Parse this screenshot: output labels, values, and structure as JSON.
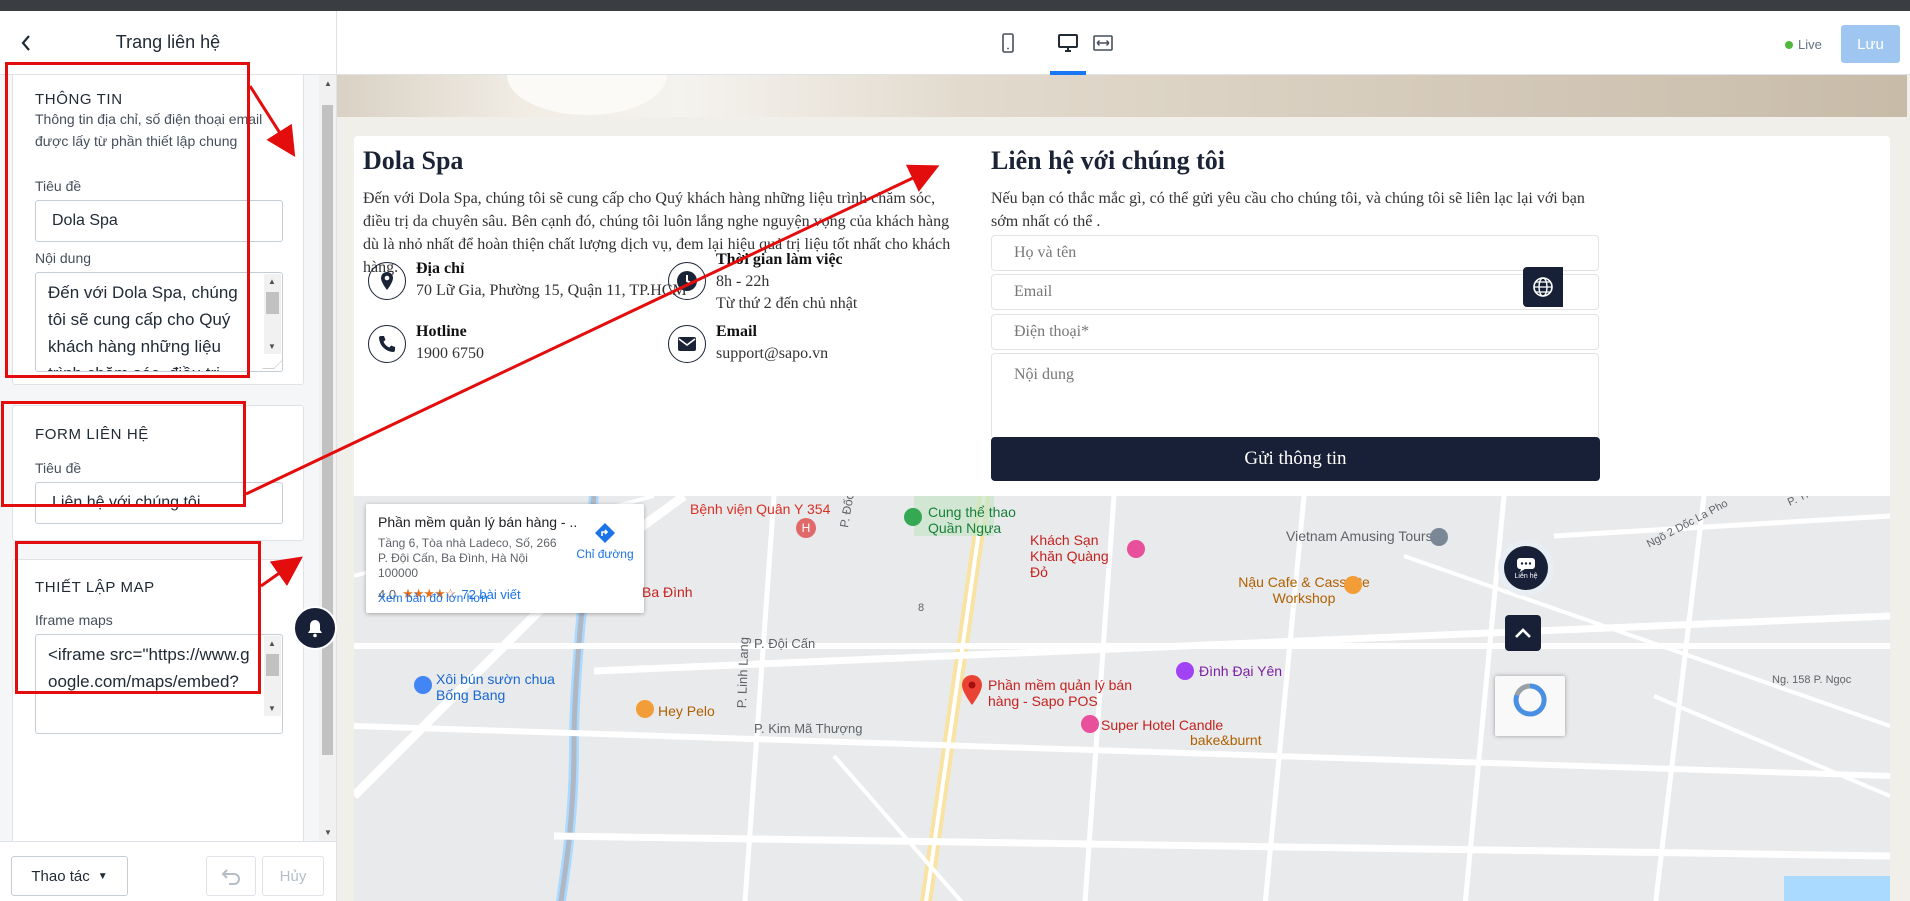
{
  "sidebar": {
    "title": "Trang liên hệ",
    "info_section": {
      "heading": "THÔNG TIN",
      "description": "Thông tin địa chỉ, số điện thoại email được lấy từ phần thiết lập chung",
      "title_label": "Tiêu đề",
      "title_value": "Dola Spa",
      "content_label": "Nội dung",
      "content_value": "Đến với Dola Spa, chúng tôi sẽ cung cấp cho Quý khách hàng những liệu trình chăm sóc, điều trị"
    },
    "form_section": {
      "heading": "FORM LIÊN HỆ",
      "title_label": "Tiêu đề",
      "title_value": "Liên hệ với chúng tôi"
    },
    "map_section": {
      "heading": "THIẾT LẬP MAP",
      "iframe_label": "Iframe maps",
      "iframe_value": "<iframe src=\"https://www.google.com/maps/embed?"
    },
    "footer": {
      "actions_label": "Thao tác",
      "cancel_label": "Hủy"
    }
  },
  "toolbar": {
    "devices": [
      "mobile-icon",
      "desktop-icon",
      "fullwidth-icon"
    ],
    "active_device": "desktop",
    "live_label": "Live",
    "save_label": "Lưu"
  },
  "preview": {
    "about": {
      "title": "Dola Spa",
      "text": "Đến với Dola Spa, chúng tôi sẽ cung cấp cho Quý khách hàng những liệu trình chăm sóc, điều trị da chuyên sâu. Bên cạnh đó, chúng tôi luôn lắng nghe nguyện vọng của khách hàng dù là nhỏ nhất để hoàn thiện chất lượng dịch vụ, đem lại hiệu quả trị liệu tốt nhất cho khách hàng.",
      "address_label": "Địa chỉ",
      "address_value": "70 Lữ Gia, Phường 15, Quận 11, TP.HCM",
      "hours_label": "Thời gian làm việc",
      "hours_value_1": "8h - 22h",
      "hours_value_2": "Từ thứ 2 đến chủ nhật",
      "hotline_label": "Hotline",
      "hotline_value": "1900 6750",
      "email_label": "Email",
      "email_value": "support@sapo.vn"
    },
    "contact": {
      "title": "Liên hệ với chúng tôi",
      "text": "Nếu bạn có thắc mắc gì, có thể gửi yêu cầu cho chúng tôi, và chúng tôi sẽ liên lạc lại với bạn sớm nhất có thể .",
      "name_placeholder": "Họ và tên",
      "email_placeholder": "Email",
      "phone_placeholder": "Điện thoại*",
      "message_placeholder": "Nội dung",
      "submit_label": "Gửi thông tin"
    },
    "map": {
      "place_name": "Phần mềm quản lý bán hàng - ...",
      "place_address": "Tầng 6, Tòa nhà Ladeco, Số, 266 P. Đội Cấn, Ba Đình, Hà Nội 100000",
      "rating": "4,0",
      "stars": "★★★★☆",
      "reviews": "72 bài viết",
      "directions": "Chỉ đường",
      "larger_map": "Xem bản đồ lớn hơn",
      "labels": {
        "hospital": "Bệnh viện Quân Y 354",
        "sports": "Cung thể thao Quần Ngựa",
        "hotel1": "Khách Sạn Khăn Quàng Đỏ",
        "tours": "Vietnam Amusing Tours",
        "cafe": "Nậu Cafe & Cassette Workshop",
        "badinh": "Ba Đình",
        "docngu": "P. Đốc Ngữ",
        "doican": "P. Đội Cấn",
        "linhlang": "P. Linh Lang",
        "kimma": "P. Kim Mã Thượng",
        "xoi": "Xôi bún sườn chua Bống Bang",
        "heypelo": "Hey Pelo",
        "sapo": "Phần mềm quản lý bán hàng - Sapo POS",
        "dinh": "Đình Đại Yên",
        "superhotel": "Super Hotel Candle",
        "bake": "bake&burnt",
        "docla": "Ngõ 2 Dốc La Pho",
        "ng158": "Ng. 158 P. Ngọc",
        "thuyk": "P. Thụy K",
        "num8": "8"
      }
    },
    "chat_label": "Liên hệ"
  },
  "colors": {
    "annotation": "#e40d0d",
    "brand_dark": "#172036",
    "save_button": "#9fc6f0"
  }
}
